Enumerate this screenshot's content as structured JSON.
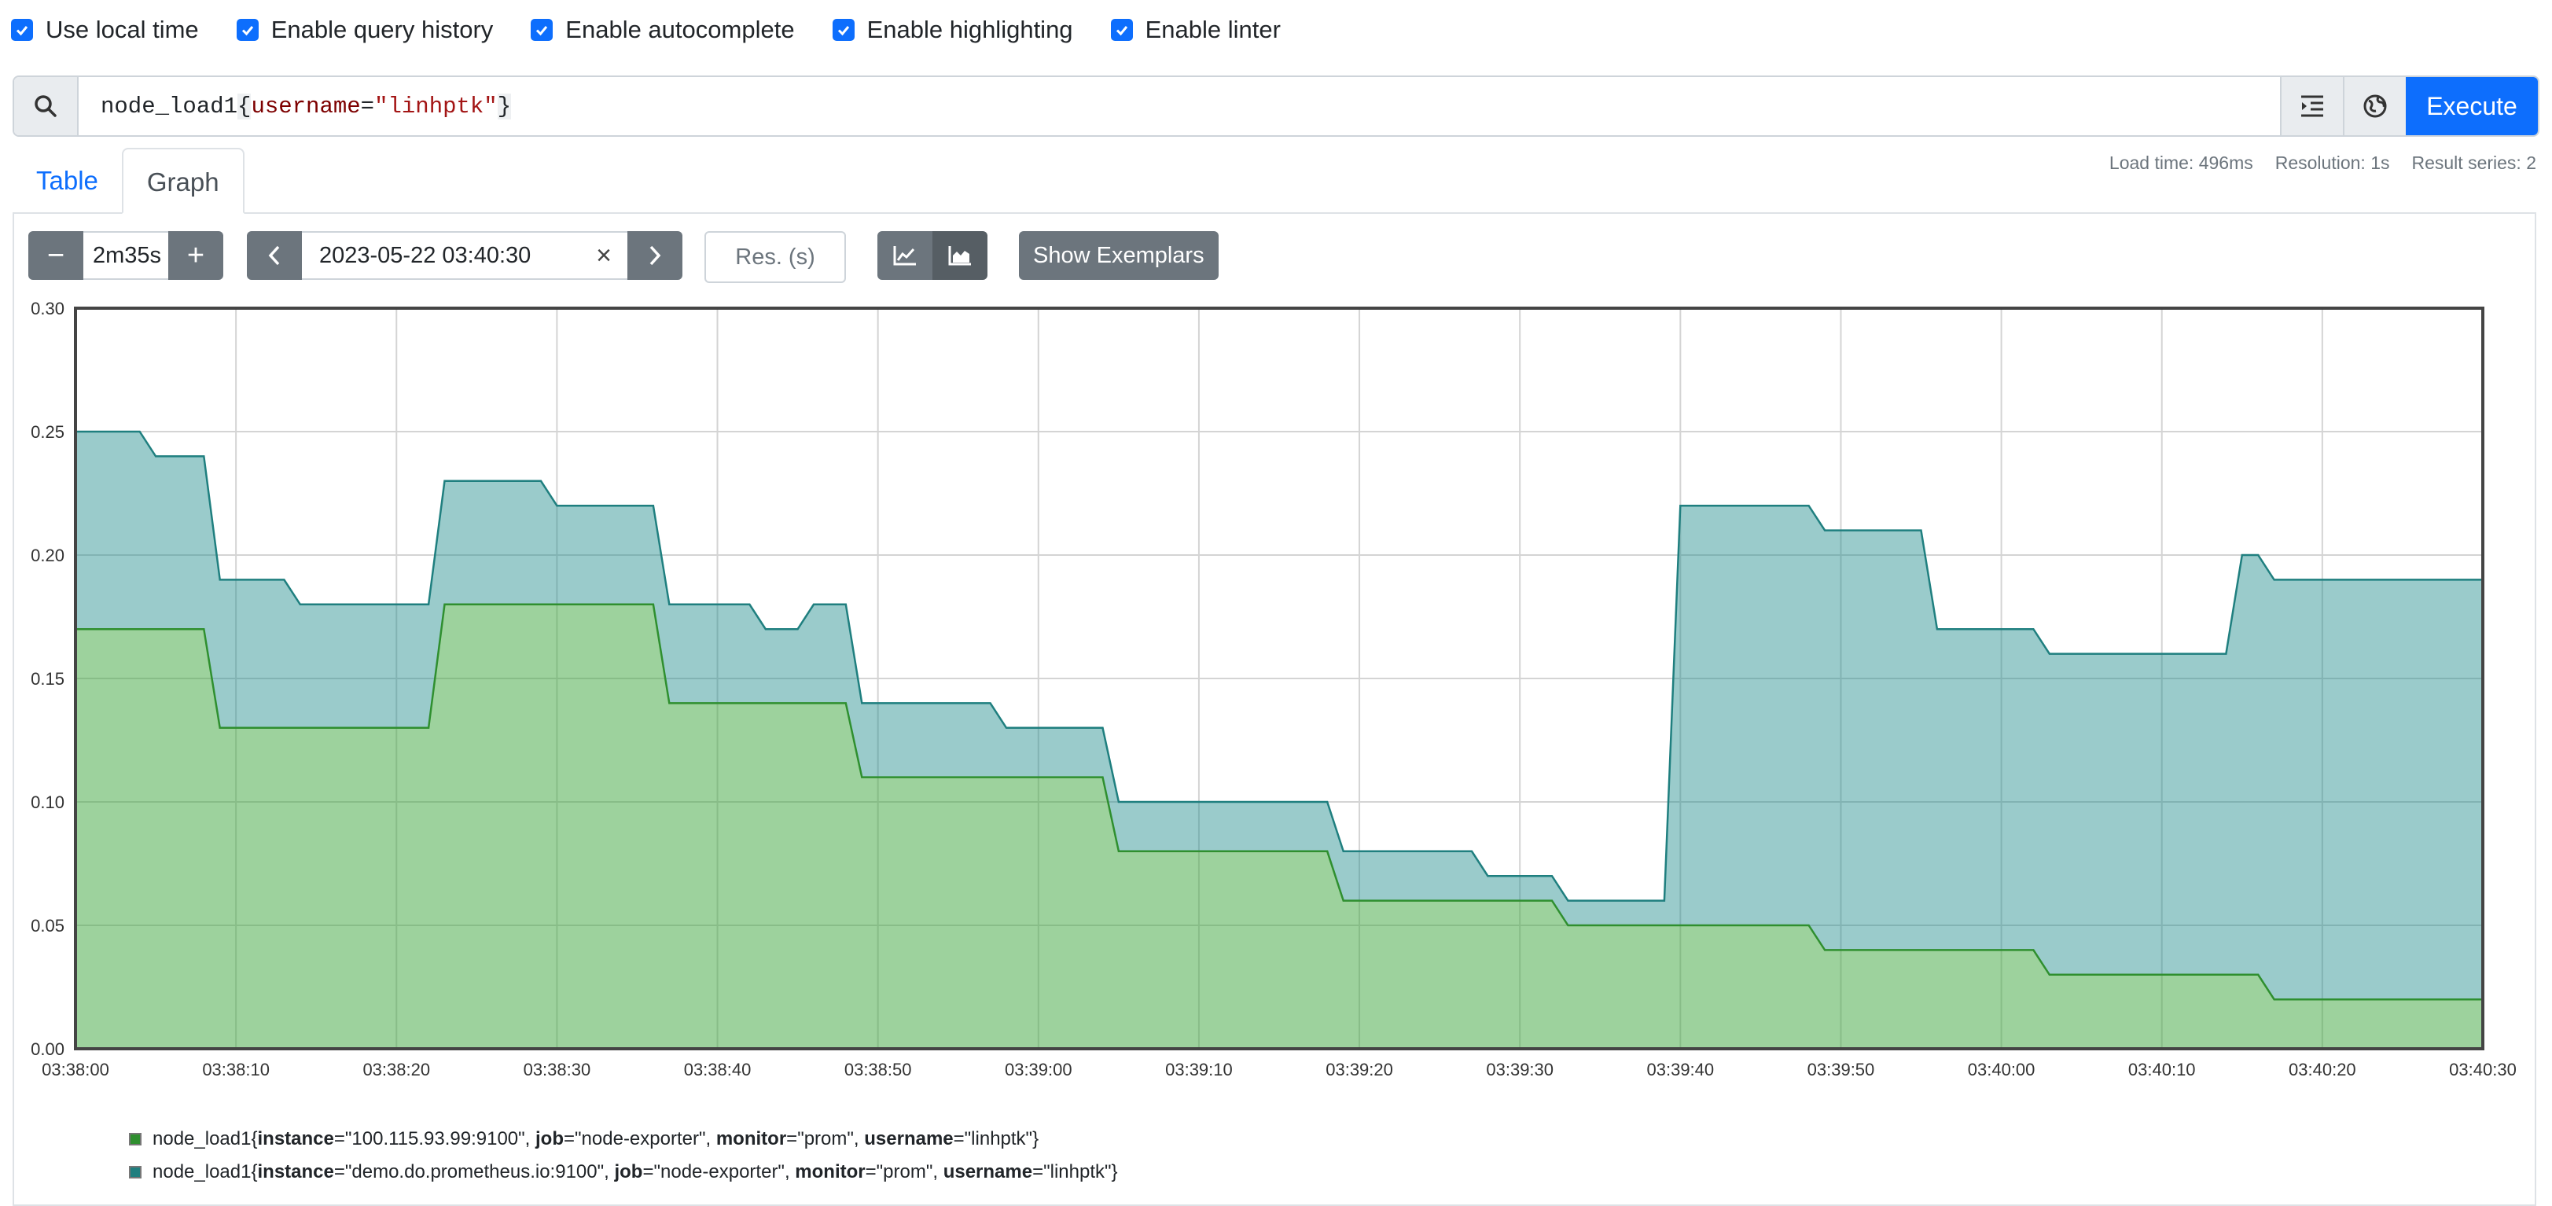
{
  "options": [
    {
      "label": "Use local time",
      "checked": true
    },
    {
      "label": "Enable query history",
      "checked": true
    },
    {
      "label": "Enable autocomplete",
      "checked": true
    },
    {
      "label": "Enable highlighting",
      "checked": true
    },
    {
      "label": "Enable linter",
      "checked": true
    }
  ],
  "query": {
    "metric": "node_load1",
    "open_brace": "{",
    "label_name": "username",
    "operator": "=",
    "label_value": "\"linhptk\"",
    "close_brace": "}",
    "execute_label": "Execute"
  },
  "tabs": {
    "table": "Table",
    "graph": "Graph"
  },
  "stats": {
    "load_time": "Load time: 496ms",
    "resolution": "Resolution: 1s",
    "result_series": "Result series: 2"
  },
  "controls": {
    "range": "2m35s",
    "end_time": "2023-05-22 03:40:30",
    "resolution_placeholder": "Res. (s)",
    "show_exemplars": "Show Exemplars",
    "minus": "−",
    "plus": "+",
    "clear": "×"
  },
  "colors": {
    "series_1": "#2f8f2f",
    "series_2": "#1f7f7f",
    "accent": "#0d6efd"
  },
  "chart_data": {
    "type": "area",
    "stacked": true,
    "x": [
      "03:38:00",
      "03:38:10",
      "03:38:20",
      "03:38:30",
      "03:38:40",
      "03:38:50",
      "03:39:00",
      "03:39:10",
      "03:39:20",
      "03:39:30",
      "03:39:40",
      "03:39:50",
      "03:40:00",
      "03:40:10",
      "03:40:20",
      "03:40:30"
    ],
    "ylim": [
      0,
      0.3
    ],
    "yticks": [
      "0.00",
      "0.05",
      "0.10",
      "0.15",
      "0.20",
      "0.25",
      "0.30"
    ],
    "grid": true,
    "series": [
      {
        "name": "node_load1{instance=\"100.115.93.99:9100\", job=\"node-exporter\", monitor=\"prom\", username=\"linhptk\"}",
        "color": "#2f8f2f",
        "steps": [
          [
            0,
            0.17
          ],
          [
            9,
            0.13
          ],
          [
            23,
            0.18
          ],
          [
            37,
            0.14
          ],
          [
            49,
            0.11
          ],
          [
            65,
            0.08
          ],
          [
            79,
            0.06
          ],
          [
            93,
            0.05
          ],
          [
            109,
            0.04
          ],
          [
            123,
            0.03
          ],
          [
            137,
            0.02
          ],
          [
            150,
            0.02
          ]
        ]
      },
      {
        "name": "node_load1{instance=\"demo.do.prometheus.io:9100\", job=\"node-exporter\", monitor=\"prom\", username=\"linhptk\"}",
        "color": "#1f7f7f",
        "steps": [
          [
            0,
            0.08
          ],
          [
            5,
            0.07
          ],
          [
            9,
            0.06
          ],
          [
            14,
            0.05
          ],
          [
            17,
            0.05
          ],
          [
            23,
            0.05
          ],
          [
            30,
            0.04
          ],
          [
            37,
            0.04
          ],
          [
            43,
            0.03
          ],
          [
            46,
            0.04
          ],
          [
            49,
            0.03
          ],
          [
            55,
            0.03
          ],
          [
            58,
            0.02
          ],
          [
            65,
            0.02
          ],
          [
            74,
            0.02
          ],
          [
            79,
            0.02
          ],
          [
            88,
            0.01
          ],
          [
            93,
            0.01
          ],
          [
            94,
            0.01
          ],
          [
            100,
            0.17
          ],
          [
            104,
            0.17
          ],
          [
            109,
            0.17
          ],
          [
            116,
            0.13
          ],
          [
            119,
            0.13
          ],
          [
            123,
            0.13
          ],
          [
            135,
            0.17
          ],
          [
            137,
            0.17
          ],
          [
            150,
            0.17
          ]
        ]
      }
    ],
    "legend_items": [
      {
        "name": "node_load1",
        "labels": [
          {
            "k": "instance",
            "v": "\"100.115.93.99:9100\""
          },
          {
            "k": "job",
            "v": "\"node-exporter\""
          },
          {
            "k": "monitor",
            "v": "\"prom\""
          },
          {
            "k": "username",
            "v": "\"linhptk\""
          }
        ]
      },
      {
        "name": "node_load1",
        "labels": [
          {
            "k": "instance",
            "v": "\"demo.do.prometheus.io:9100\""
          },
          {
            "k": "job",
            "v": "\"node-exporter\""
          },
          {
            "k": "monitor",
            "v": "\"prom\""
          },
          {
            "k": "username",
            "v": "\"linhptk\""
          }
        ]
      }
    ]
  }
}
